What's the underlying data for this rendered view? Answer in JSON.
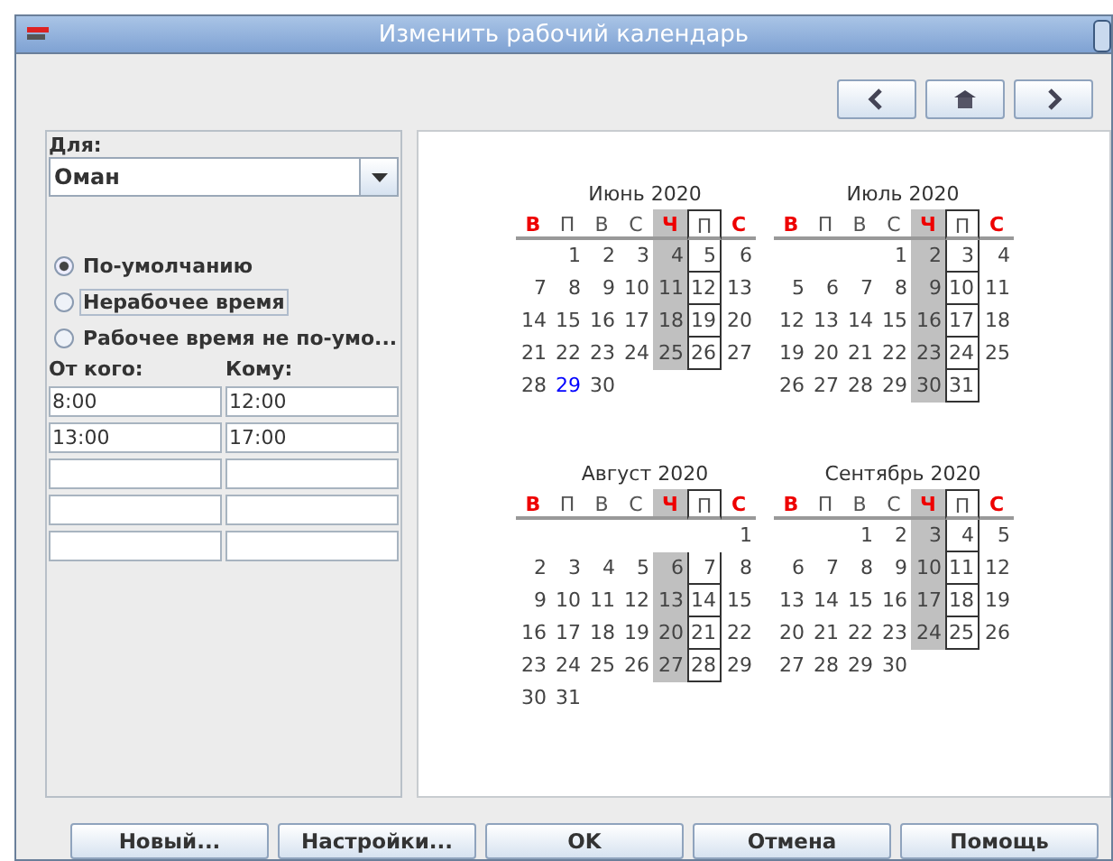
{
  "window": {
    "title": "Изменить рабочий календарь"
  },
  "nav_buttons": [
    {
      "kind": "prev"
    },
    {
      "kind": "home"
    },
    {
      "kind": "next"
    }
  ],
  "for_label": "Для:",
  "calendar_select": {
    "value": "Оман"
  },
  "day_types": [
    {
      "label": "По-умолчанию",
      "selected": true
    },
    {
      "label": "Нерабочее время",
      "selected": false,
      "focused": true
    },
    {
      "label": "Рабочее время не по-умо...",
      "selected": false
    }
  ],
  "hours": {
    "columns": [
      "От кого:",
      "Кому:"
    ],
    "rows": [
      [
        {
          "value": "8:00"
        },
        {
          "value": "12:00"
        }
      ],
      [
        {
          "value": "13:00"
        },
        {
          "value": "17:00"
        }
      ],
      [
        {},
        {}
      ],
      [
        {},
        {}
      ],
      [
        {},
        {}
      ]
    ]
  },
  "months": [
    {
      "title": "Июнь 2020",
      "weekdays": [
        {
          "label": "В",
          "weekend": true,
          "shaded": false,
          "boxed": false
        },
        {
          "label": "П",
          "weekend": false,
          "shaded": false,
          "boxed": false
        },
        {
          "label": "В",
          "weekend": false,
          "shaded": false,
          "boxed": false
        },
        {
          "label": "С",
          "weekend": false,
          "shaded": false,
          "boxed": false
        },
        {
          "label": "Ч",
          "weekend": true,
          "shaded": true,
          "boxed": false
        },
        {
          "label": "П",
          "weekend": false,
          "shaded": false,
          "boxed": true
        },
        {
          "label": "С",
          "weekend": true,
          "shaded": false,
          "boxed": false
        }
      ],
      "weeks": [
        [
          {
            "kind": "blank"
          },
          "1",
          "2",
          "3",
          "4",
          "5",
          "6"
        ],
        [
          "7",
          "8",
          "9",
          "10",
          "11",
          "12",
          "13"
        ],
        [
          "14",
          "15",
          "16",
          "17",
          "18",
          "19",
          "20"
        ],
        [
          "21",
          "22",
          "23",
          "24",
          "25",
          "26",
          "27"
        ],
        [
          "28",
          {
            "kind": "today",
            "text": "29"
          },
          "30"
        ]
      ]
    },
    {
      "title": "Июль 2020",
      "weekdays": [
        {
          "label": "В",
          "weekend": true,
          "shaded": false,
          "boxed": false
        },
        {
          "label": "П",
          "weekend": false,
          "shaded": false,
          "boxed": false
        },
        {
          "label": "В",
          "weekend": false,
          "shaded": false,
          "boxed": false
        },
        {
          "label": "С",
          "weekend": false,
          "shaded": false,
          "boxed": false
        },
        {
          "label": "Ч",
          "weekend": true,
          "shaded": true,
          "boxed": false
        },
        {
          "label": "П",
          "weekend": false,
          "shaded": false,
          "boxed": true
        },
        {
          "label": "С",
          "weekend": true,
          "shaded": false,
          "boxed": false
        }
      ],
      "weeks": [
        [
          {
            "kind": "blank"
          },
          {
            "kind": "blank"
          },
          {
            "kind": "blank"
          },
          "1",
          "2",
          "3",
          "4"
        ],
        [
          "5",
          "6",
          "7",
          "8",
          "9",
          "10",
          "11"
        ],
        [
          "12",
          "13",
          "14",
          "15",
          "16",
          "17",
          "18"
        ],
        [
          "19",
          "20",
          "21",
          "22",
          "23",
          "24",
          "25"
        ],
        [
          "26",
          "27",
          "28",
          "29",
          "30",
          "31"
        ]
      ]
    },
    {
      "title": "Август 2020",
      "weekdays": [
        {
          "label": "В",
          "weekend": true,
          "shaded": false,
          "boxed": false
        },
        {
          "label": "П",
          "weekend": false,
          "shaded": false,
          "boxed": false
        },
        {
          "label": "В",
          "weekend": false,
          "shaded": false,
          "boxed": false
        },
        {
          "label": "С",
          "weekend": false,
          "shaded": false,
          "boxed": false
        },
        {
          "label": "Ч",
          "weekend": true,
          "shaded": true,
          "boxed": false
        },
        {
          "label": "П",
          "weekend": false,
          "shaded": false,
          "boxed": true
        },
        {
          "label": "С",
          "weekend": true,
          "shaded": false,
          "boxed": false
        }
      ],
      "weeks": [
        [
          {
            "kind": "blank"
          },
          {
            "kind": "blank"
          },
          {
            "kind": "blank"
          },
          {
            "kind": "blank"
          },
          {
            "kind": "blank"
          },
          {
            "kind": "blank"
          },
          "1"
        ],
        [
          "2",
          "3",
          "4",
          "5",
          "6",
          "7",
          "8"
        ],
        [
          "9",
          "10",
          "11",
          "12",
          "13",
          "14",
          "15"
        ],
        [
          "16",
          "17",
          "18",
          "19",
          "20",
          "21",
          "22"
        ],
        [
          "23",
          "24",
          "25",
          "26",
          "27",
          "28",
          "29"
        ],
        [
          "30",
          "31"
        ]
      ]
    },
    {
      "title": "Сентябрь 2020",
      "weekdays": [
        {
          "label": "В",
          "weekend": true,
          "shaded": false,
          "boxed": false
        },
        {
          "label": "П",
          "weekend": false,
          "shaded": false,
          "boxed": false
        },
        {
          "label": "В",
          "weekend": false,
          "shaded": false,
          "boxed": false
        },
        {
          "label": "С",
          "weekend": false,
          "shaded": false,
          "boxed": false
        },
        {
          "label": "Ч",
          "weekend": true,
          "shaded": true,
          "boxed": false
        },
        {
          "label": "П",
          "weekend": false,
          "shaded": false,
          "boxed": true
        },
        {
          "label": "С",
          "weekend": true,
          "shaded": false,
          "boxed": false
        }
      ],
      "weeks": [
        [
          {
            "kind": "blank"
          },
          {
            "kind": "blank"
          },
          "1",
          "2",
          "3",
          "4",
          "5"
        ],
        [
          "6",
          "7",
          "8",
          "9",
          "10",
          "11",
          "12"
        ],
        [
          "13",
          "14",
          "15",
          "16",
          "17",
          "18",
          "19"
        ],
        [
          "20",
          "21",
          "22",
          "23",
          "24",
          "25",
          "26"
        ],
        [
          "27",
          "28",
          "29",
          "30"
        ]
      ]
    }
  ],
  "buttons": [
    "Новый...",
    "Настройки...",
    "OK",
    "Отмена",
    "Помощь"
  ]
}
